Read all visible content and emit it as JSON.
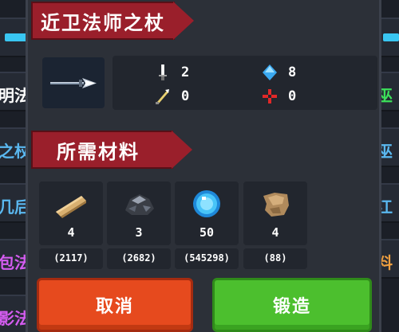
{
  "background_list": {
    "left_items": [
      {
        "label": "明法",
        "color": "#ffffff"
      },
      {
        "label": "之杖",
        "color": "#5ab8f0"
      },
      {
        "label": "几后",
        "color": "#5ab8f0"
      },
      {
        "label": "包法",
        "color": "#d45cf0"
      },
      {
        "label": "影法",
        "color": "#d45cf0"
      }
    ],
    "right_items": [
      {
        "label": "巫",
        "color": "#3ce05a"
      },
      {
        "label": "巫",
        "color": "#5ab8f0"
      },
      {
        "label": "江",
        "color": "#5ab8f0"
      },
      {
        "label": "料",
        "color": "#f0a040"
      }
    ]
  },
  "weapon": {
    "name": "近卫法师之杖",
    "icon": "spear-staff-icon"
  },
  "stats": {
    "attack": {
      "icon": "sword-icon",
      "value": "2"
    },
    "energy": {
      "icon": "blue-gem-icon",
      "value": "8"
    },
    "crit": {
      "icon": "dagger-slash-icon",
      "value": "0"
    },
    "accuracy": {
      "icon": "red-cross-icon",
      "value": "0"
    }
  },
  "materials_title": "所需材料",
  "materials": [
    {
      "icon": "wood-plank-icon",
      "required": "4",
      "owned": "(2117)"
    },
    {
      "icon": "iron-ore-icon",
      "required": "3",
      "owned": "(2682)"
    },
    {
      "icon": "blue-orb-icon",
      "required": "50",
      "owned": "(545298)"
    },
    {
      "icon": "leather-scrap-icon",
      "required": "4",
      "owned": "(88)"
    }
  ],
  "buttons": {
    "cancel": "取消",
    "forge": "锻造"
  }
}
